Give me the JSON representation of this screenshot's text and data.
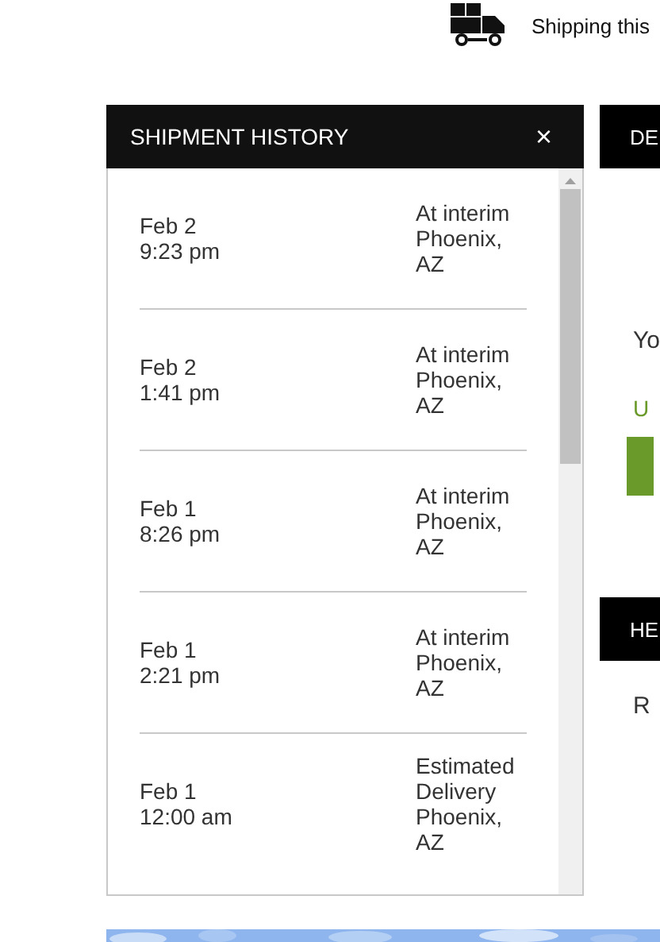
{
  "top_bar": {
    "label": "Shipping this"
  },
  "history_panel": {
    "title": "SHIPMENT HISTORY",
    "close": "×",
    "events": [
      {
        "date": "Feb 2",
        "time": "9:23 pm",
        "status": "At interim",
        "location": "Phoenix, AZ"
      },
      {
        "date": "Feb 2",
        "time": "1:41 pm",
        "status": "At interim",
        "location": "Phoenix, AZ"
      },
      {
        "date": "Feb 1",
        "time": "8:26 pm",
        "status": "At interim",
        "location": "Phoenix, AZ"
      },
      {
        "date": "Feb 1",
        "time": "2:21 pm",
        "status": "At interim",
        "location": "Phoenix, AZ"
      },
      {
        "date": "Feb 1",
        "time": "12:00 am",
        "status": "Estimated Delivery",
        "location": "Phoenix, AZ"
      }
    ]
  },
  "side_panels": [
    {
      "title": "DE",
      "text": "Yo",
      "link": "U",
      "has_button": true
    },
    {
      "title": "HE",
      "text": "R"
    }
  ]
}
